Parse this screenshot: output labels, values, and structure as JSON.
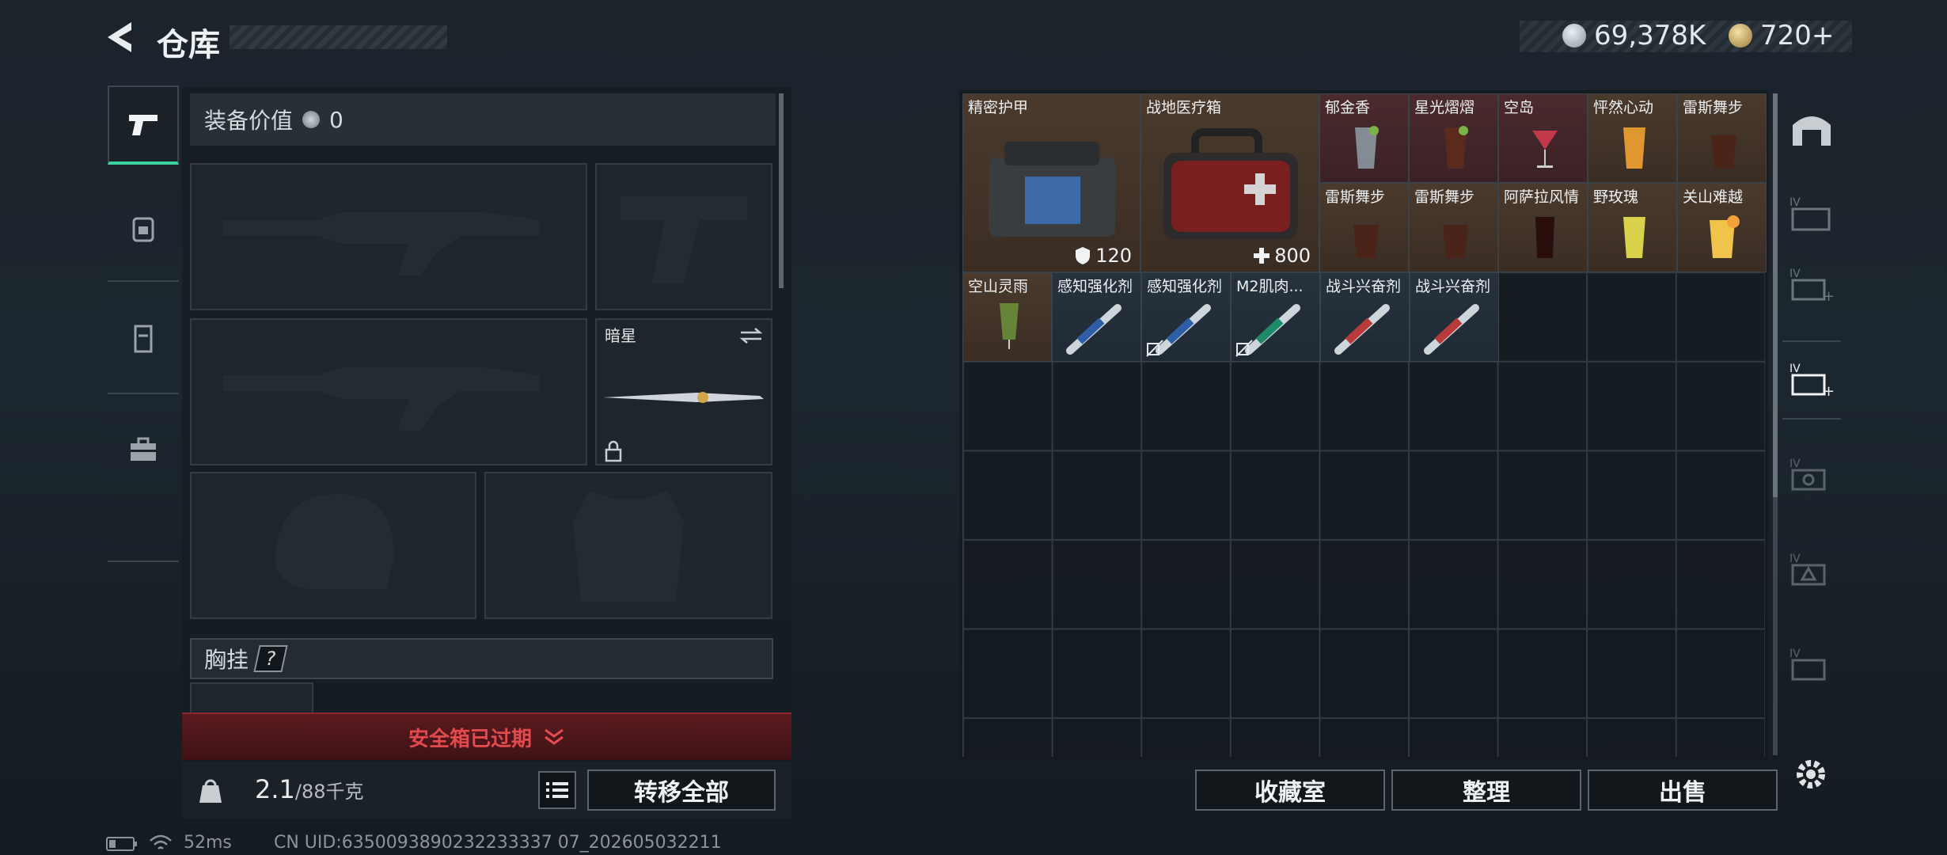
{
  "header": {
    "title": "仓库",
    "silver": "69,378K",
    "gold": "720+"
  },
  "tabs": [
    {
      "name": "weapons",
      "icon": "pistol-icon"
    },
    {
      "name": "backpack",
      "icon": "backpack-icon"
    },
    {
      "name": "vest",
      "icon": "vest-icon"
    },
    {
      "name": "toolbox",
      "icon": "toolbox-icon"
    }
  ],
  "loadout": {
    "equip_label": "装备价值",
    "equip_value": "0",
    "melee_label": "暗星",
    "chest_label": "胸挂",
    "chest_help": "?",
    "alert": "安全箱已过期",
    "weight_current": "2.1",
    "weight_max": "/88千克",
    "transfer_all": "转移全部"
  },
  "stash": {
    "items": [
      {
        "label": "精密护甲",
        "value": "120",
        "color": "brown"
      },
      {
        "label": "战地医疗箱",
        "value": "800",
        "color": "brown"
      },
      {
        "label": "郁金香",
        "color": "red"
      },
      {
        "label": "星光熠熠",
        "color": "red"
      },
      {
        "label": "空岛",
        "color": "red"
      },
      {
        "label": "怦然心动",
        "color": "brown"
      },
      {
        "label": "雷斯舞步",
        "color": "brown"
      },
      {
        "label": "雷斯舞步",
        "color": "brown"
      },
      {
        "label": "雷斯舞步",
        "color": "brown"
      },
      {
        "label": "阿萨拉风情",
        "color": "brown"
      },
      {
        "label": "野玫瑰",
        "color": "brown"
      },
      {
        "label": "关山难越",
        "color": "brown"
      },
      {
        "label": "空山灵雨",
        "color": "brown"
      },
      {
        "label": "感知强化剂",
        "color": "blue"
      },
      {
        "label": "感知强化剂",
        "color": "blue"
      },
      {
        "label": "M2肌肉...",
        "color": "blue"
      },
      {
        "label": "战斗兴奋剂",
        "color": "blue"
      },
      {
        "label": "战斗兴奋剂",
        "color": "blue"
      }
    ],
    "collection": "收藏室",
    "sort": "整理",
    "sell": "出售"
  },
  "status": {
    "ping": "52ms",
    "uid": "CN UID:6350093890232233337 07_202605032211"
  },
  "colors": {
    "accent": "#39d3a0",
    "alert": "#e24a4e"
  }
}
